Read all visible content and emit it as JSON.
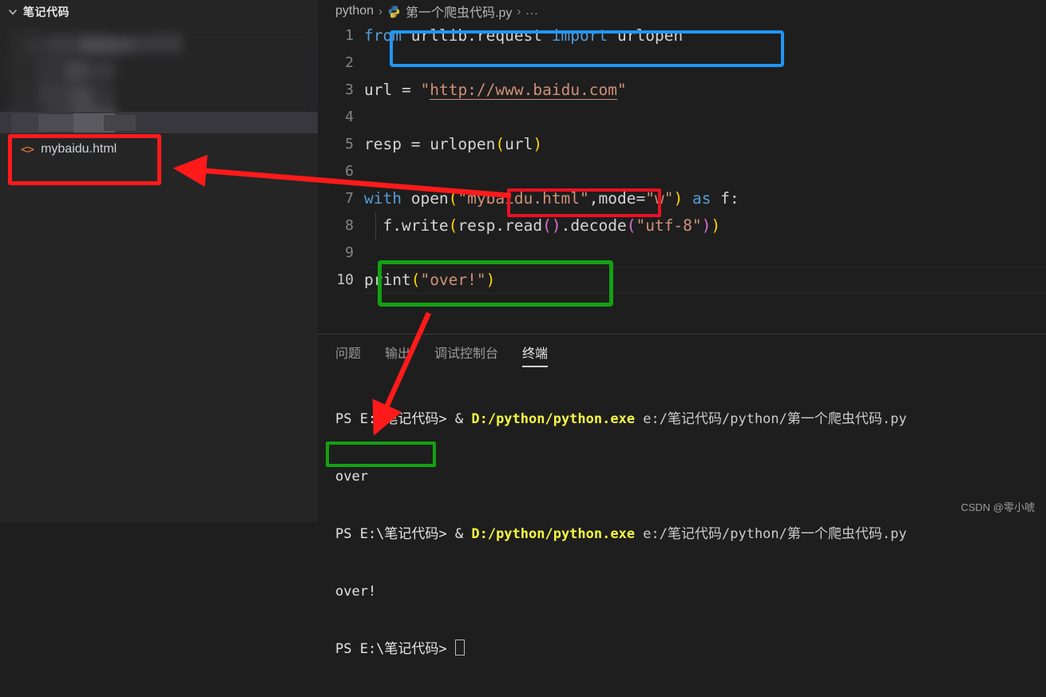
{
  "sidebar": {
    "header_label": "笔记代码",
    "chevron_icon": "chevron-down-icon",
    "file_icon": "code-file-icon",
    "file_label": "mybaidu.html"
  },
  "breadcrumb": {
    "root": "python",
    "separator": "›",
    "python_icon": "python-logo-icon",
    "file": "第一个爬虫代码.py",
    "overflow": "..."
  },
  "editor": {
    "lines": [
      {
        "n": "1",
        "text": "from urllib.request import urlopen"
      },
      {
        "n": "2",
        "text": ""
      },
      {
        "n": "3",
        "text": "url = \"http://www.baidu.com\""
      },
      {
        "n": "4",
        "text": ""
      },
      {
        "n": "5",
        "text": "resp = urlopen(url)"
      },
      {
        "n": "6",
        "text": ""
      },
      {
        "n": "7",
        "text": "with open(\"mybaidu.html\",mode=\"w\") as f:"
      },
      {
        "n": "8",
        "text": "    f.write(resp.read().decode(\"utf-8\"))"
      },
      {
        "n": "9",
        "text": ""
      },
      {
        "n": "10",
        "text": "print(\"over!\")"
      }
    ]
  },
  "panel": {
    "tabs": [
      {
        "label": "问题",
        "active": false
      },
      {
        "label": "输出",
        "active": false
      },
      {
        "label": "调试控制台",
        "active": false
      },
      {
        "label": "终端",
        "active": true
      }
    ],
    "terminal": {
      "prompt_1": "PS E:\\笔记代码> & ",
      "cmd_path_1": "D:/python/python.exe",
      "cmd_arg_1": " e:/笔记代码/python/第一个爬虫代码.py",
      "output_1": "over",
      "prompt_2": "PS E:\\笔记代码> & ",
      "cmd_path_2": "D:/python/python.exe",
      "cmd_arg_2": " e:/笔记代码/python/第一个爬虫代码.py",
      "output_2": "over!",
      "prompt_3": "PS E:\\笔记代码> "
    }
  },
  "annotations": {
    "blue_box_target": "from urllib.request import urlopen",
    "red_box_file_target": "mybaidu.html",
    "red_box_string_target": "\"mybaidu.html\"",
    "green_box_print_target": "print(\"over!\")",
    "green_box_output_target": "over!",
    "colors": {
      "blue": "#2196f3",
      "red": "#e81123",
      "green": "#12a112"
    }
  },
  "watermark": {
    "text": "CSDN @零小唬"
  }
}
